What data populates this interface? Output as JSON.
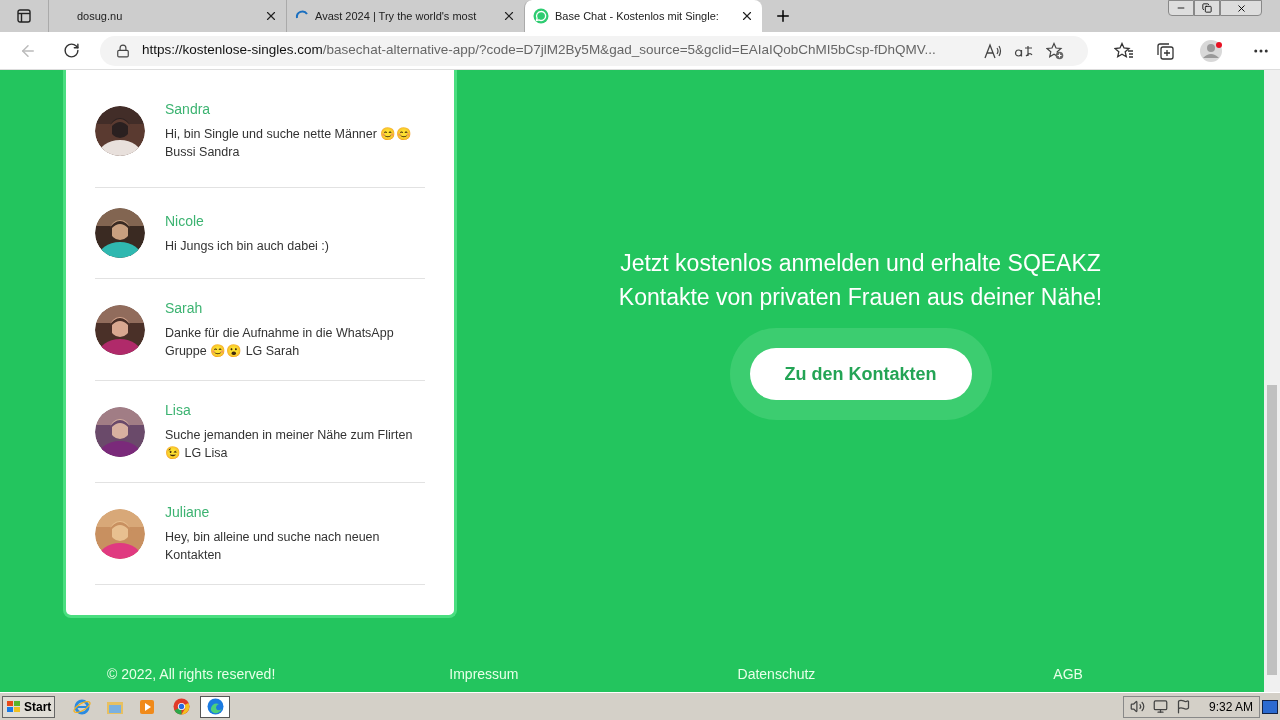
{
  "browser": {
    "tabs": [
      {
        "title": "dosug.nu",
        "selected": false,
        "loading": false
      },
      {
        "title": "Avast 2024 | Try the world's most",
        "selected": false,
        "loading": true
      },
      {
        "title": "Base Chat - Kostenlos mit Single:",
        "selected": true,
        "loading": false
      }
    ],
    "url_host": "https://kostenlose-singles.com",
    "url_rest": "/basechat-alternative-app/?code=D7jlM2By5M&gad_source=5&gclid=EAIaIQobChMI5bCsp-fDhQMV..."
  },
  "chat_list": [
    {
      "name": "Sandra",
      "message": "Hi, bin Single und suche nette Männer 😊😊 Bussi Sandra"
    },
    {
      "name": "Nicole",
      "message": "Hi Jungs ich bin auch dabei :)"
    },
    {
      "name": "Sarah",
      "message": "Danke für die Aufnahme in die WhatsApp Gruppe 😊😮 LG Sarah"
    },
    {
      "name": "Lisa",
      "message": "Suche jemanden in meiner Nähe zum Flirten 😉 LG Lisa"
    },
    {
      "name": "Juliane",
      "message": "Hey, bin alleine und suche nach neuen Kontakten"
    }
  ],
  "hero": {
    "headline": "Jetzt kostenlos anmelden und erhalte SQEAKZ Kontakte von privaten Frauen aus deiner Nähe!",
    "button": "Zu den Kontakten"
  },
  "footer": [
    "© 2022, All rights reserved!",
    "Impressum",
    "Datenschutz",
    "AGB"
  ],
  "taskbar": {
    "start": "Start",
    "time": "9:32 AM"
  }
}
